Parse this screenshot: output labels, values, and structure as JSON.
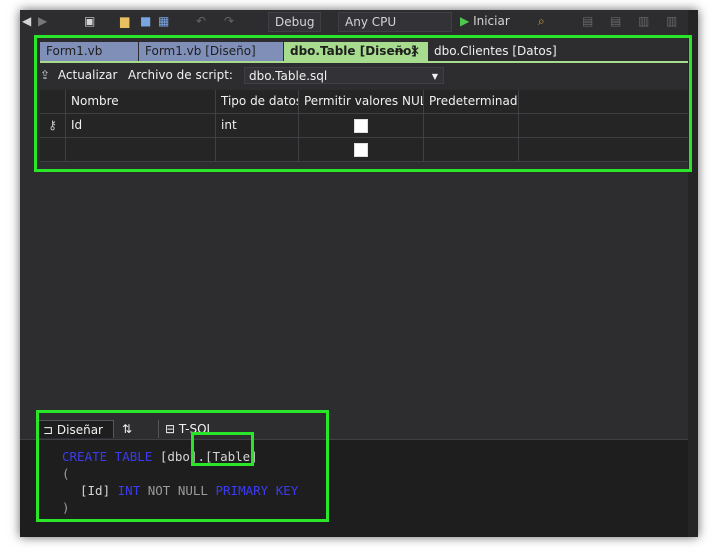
{
  "toolbar": {
    "config": "Debug",
    "platform": "Any CPU",
    "start_label": "Iniciar"
  },
  "tabs": [
    {
      "label": "Form1.vb",
      "state": "inactive"
    },
    {
      "label": "Form1.vb [Diseño]",
      "state": "inactive"
    },
    {
      "label": "dbo.Table [Diseño]",
      "state": "active"
    },
    {
      "label": "dbo.Clientes [Datos]",
      "state": "plain"
    }
  ],
  "scriptbar": {
    "refresh_label": "Actualizar",
    "script_label": "Archivo de script:",
    "script_file": "dbo.Table.sql"
  },
  "grid": {
    "headers": [
      "Nombre",
      "Tipo de datos",
      "Permitir valores NULL",
      "Predeterminado"
    ],
    "rows": [
      {
        "name": "Id",
        "type": "int",
        "allow_null": false,
        "default": "",
        "primary_key": true
      },
      {
        "name": "",
        "type": "",
        "allow_null": false,
        "default": "",
        "primary_key": false
      }
    ]
  },
  "lower_tabs": {
    "design": "Diseñar",
    "swap": "⇅",
    "tsql": "T-SQL"
  },
  "code": {
    "line1_kw": "CREATE TABLE",
    "line1_schema": "[dbo",
    "line1_dot": "].",
    "line1_table": "[Table]",
    "line2": "(",
    "line3_col": "[Id]",
    "line3_type": "INT",
    "line3_null": "NOT NULL",
    "line3_pk": "PRIMARY KEY",
    "line4": ")"
  },
  "colors": {
    "highlight": "#29e629",
    "active_tab": "#a7dc8e",
    "inactive_tab": "#7f8fb8",
    "background": "#2d2d30",
    "keyword": "#3b3bf0"
  }
}
